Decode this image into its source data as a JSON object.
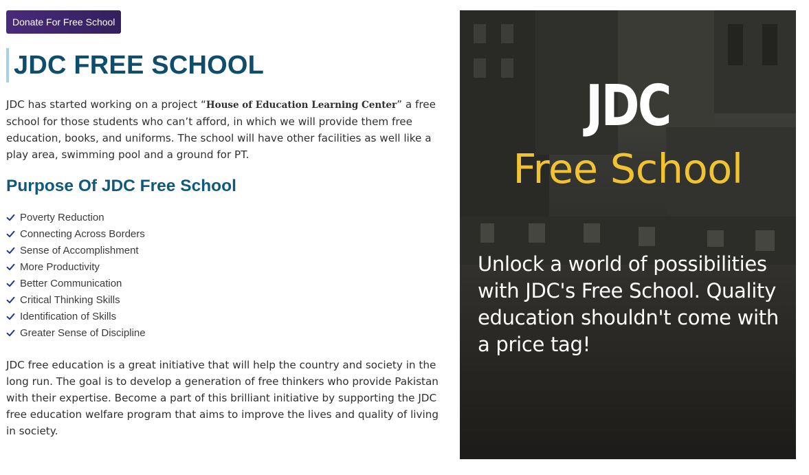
{
  "donate_button": {
    "label": "Donate For Free School"
  },
  "page_title": "JDC FREE SCHOOL",
  "intro": {
    "before_quote": "JDC has started working on a project “",
    "project_name": "House of Education Learning Center",
    "after_quote": "” a free school for those students who can’t afford, in which we will provide them free education, books, and uniforms. The school will have other facilities as well like a play area, swimming pool and a ground for PT."
  },
  "purpose_heading": "Purpose Of JDC Free School",
  "purpose_items": [
    {
      "label": "Poverty Reduction",
      "icon": "check-icon"
    },
    {
      "label": "Connecting Across Borders",
      "icon": "check-icon"
    },
    {
      "label": "Sense of Accomplishment",
      "icon": "check-icon"
    },
    {
      "label": "More Productivity",
      "icon": "check-icon"
    },
    {
      "label": "Better Communication",
      "icon": "check-icon"
    },
    {
      "label": "Critical Thinking Skills",
      "icon": "check-icon"
    },
    {
      "label": "Identification of Skills",
      "icon": "check-icon"
    },
    {
      "label": "Greater Sense of Discipline",
      "icon": "check-icon"
    }
  ],
  "outro": "JDC free education is a great initiative that will help the country and society in the long run. The goal is to develop a generation of free thinkers who provide Pakistan with their expertise. Become a part of this brilliant initiative by supporting the JDC free education welfare program that aims to improve the lives and quality of living in society.",
  "poster": {
    "brand": "JDC",
    "headline": "Free School",
    "tagline": "Unlock a world of possibilities with JDC's Free School. Quality education shouldn't come with a price tag!"
  },
  "colors": {
    "button_bg": "#4a2a7a",
    "title": "#0f4d6d",
    "subheading": "#0f5a7c",
    "title_border": "#a7d3de",
    "check": "#1f3c8a",
    "poster_headline": "#f1c232"
  }
}
